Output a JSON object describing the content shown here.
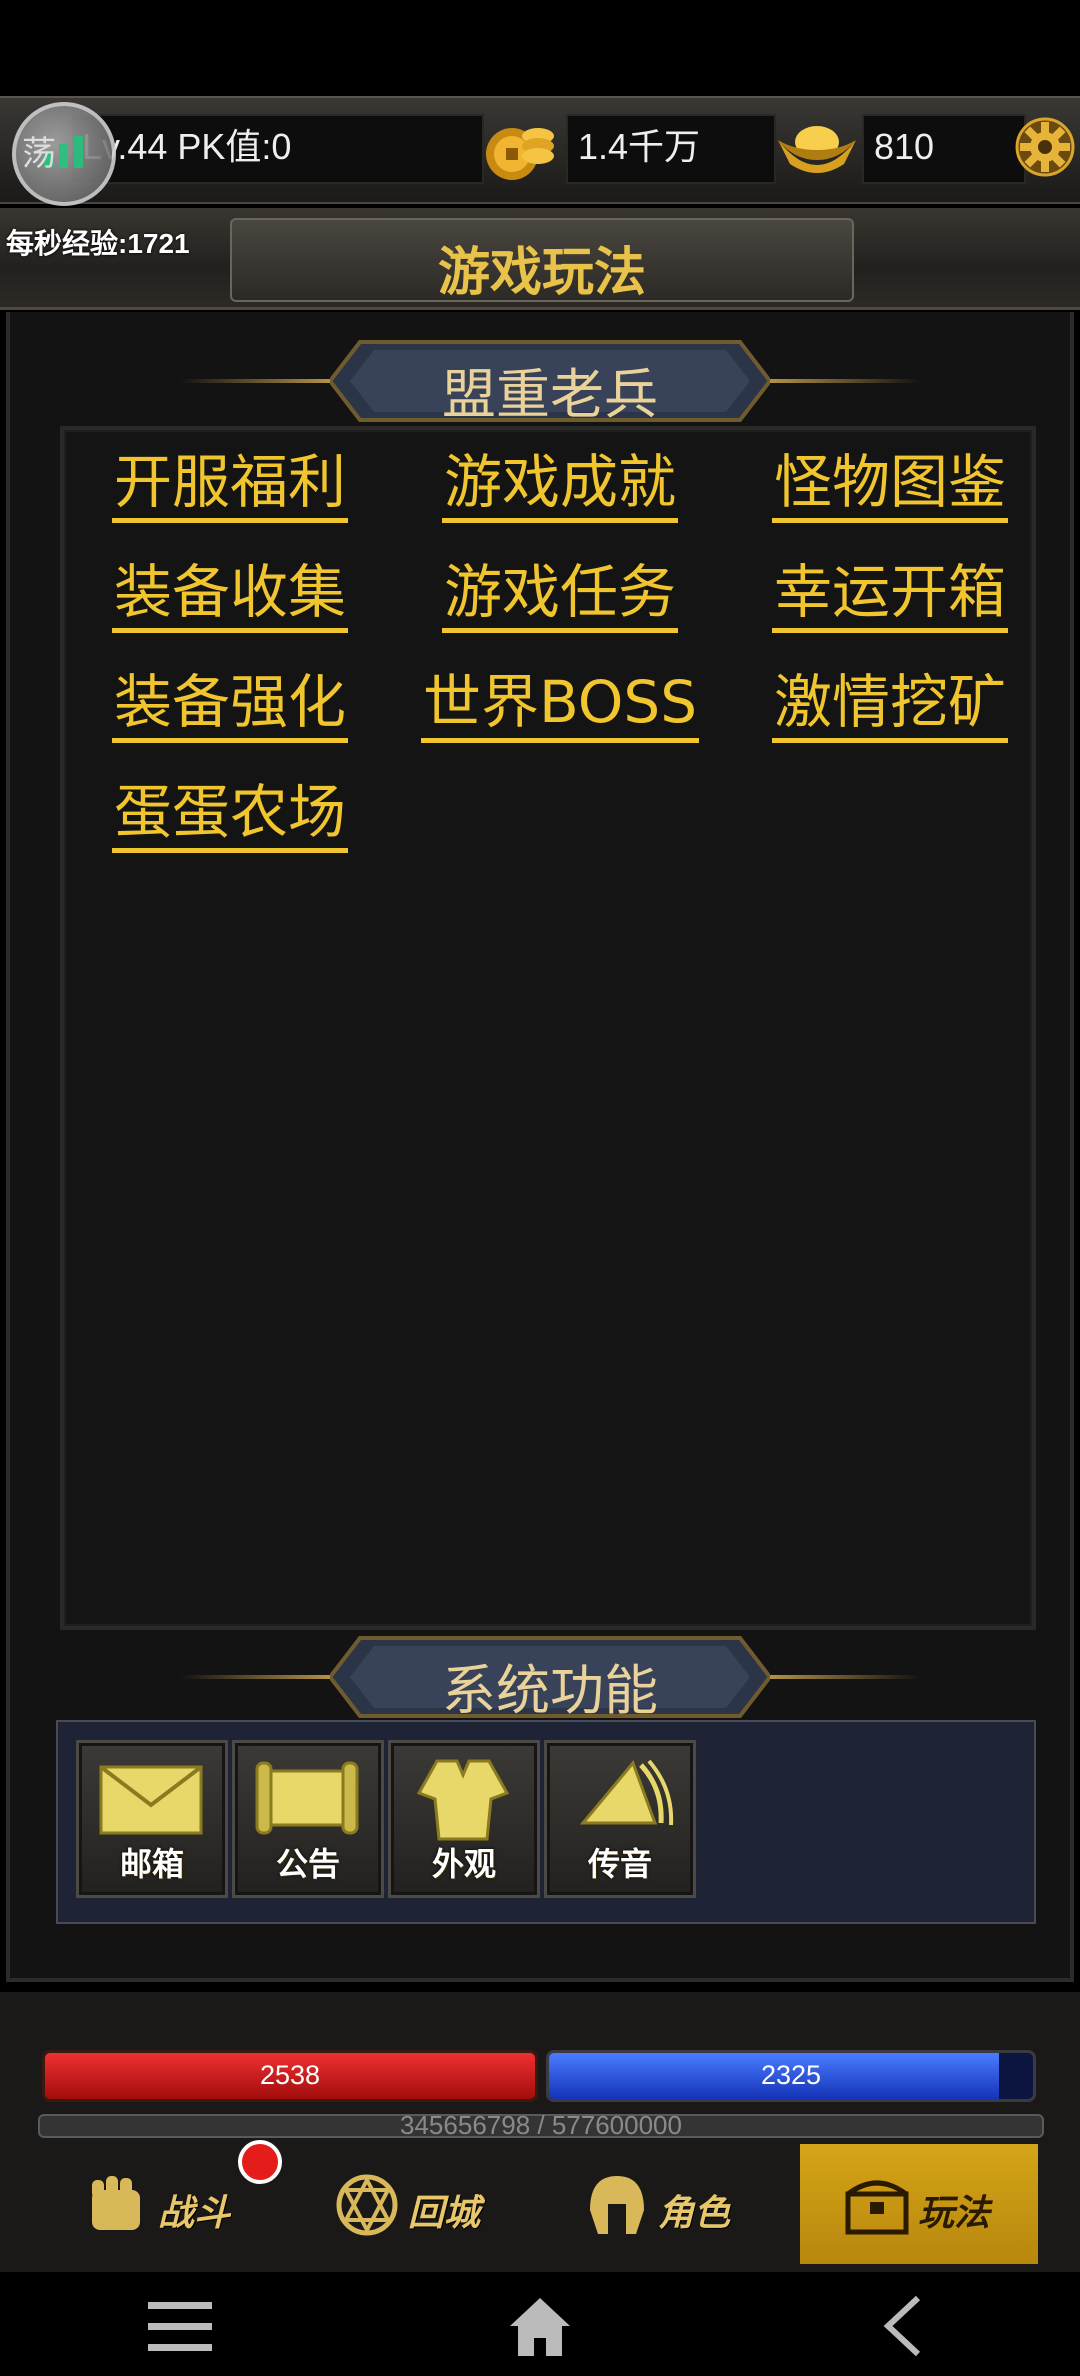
{
  "topbar": {
    "level_text": "Lv.44 PK值:0",
    "avatar_overlay_char": "荡",
    "gold_amount": "1.4千万",
    "ingot_amount": "810"
  },
  "exp_per_second": "每秒经验:1721",
  "page_title": "游戏玩法",
  "gameplay_section": {
    "header": "盟重老兵",
    "items": [
      "开服福利",
      "游戏成就",
      "怪物图鉴",
      "装备收集",
      "游戏任务",
      "幸运开箱",
      "装备强化",
      "世界BOSS",
      "激情挖矿",
      "蛋蛋农场"
    ]
  },
  "system_section": {
    "header": "系统功能",
    "buttons": [
      "邮箱",
      "公告",
      "外观",
      "传音"
    ]
  },
  "status": {
    "hp": "2538",
    "mp": "2325",
    "mp_fill_fraction": 0.93,
    "exp_text": "345656798 / 577600000"
  },
  "nav": {
    "fight": "战斗",
    "return_city": "回城",
    "character": "角色",
    "gameplay": "玩法"
  },
  "colors": {
    "accent_gold": "#f0c52e",
    "hp_red": "#d81f1f",
    "mp_blue": "#2446d8"
  }
}
